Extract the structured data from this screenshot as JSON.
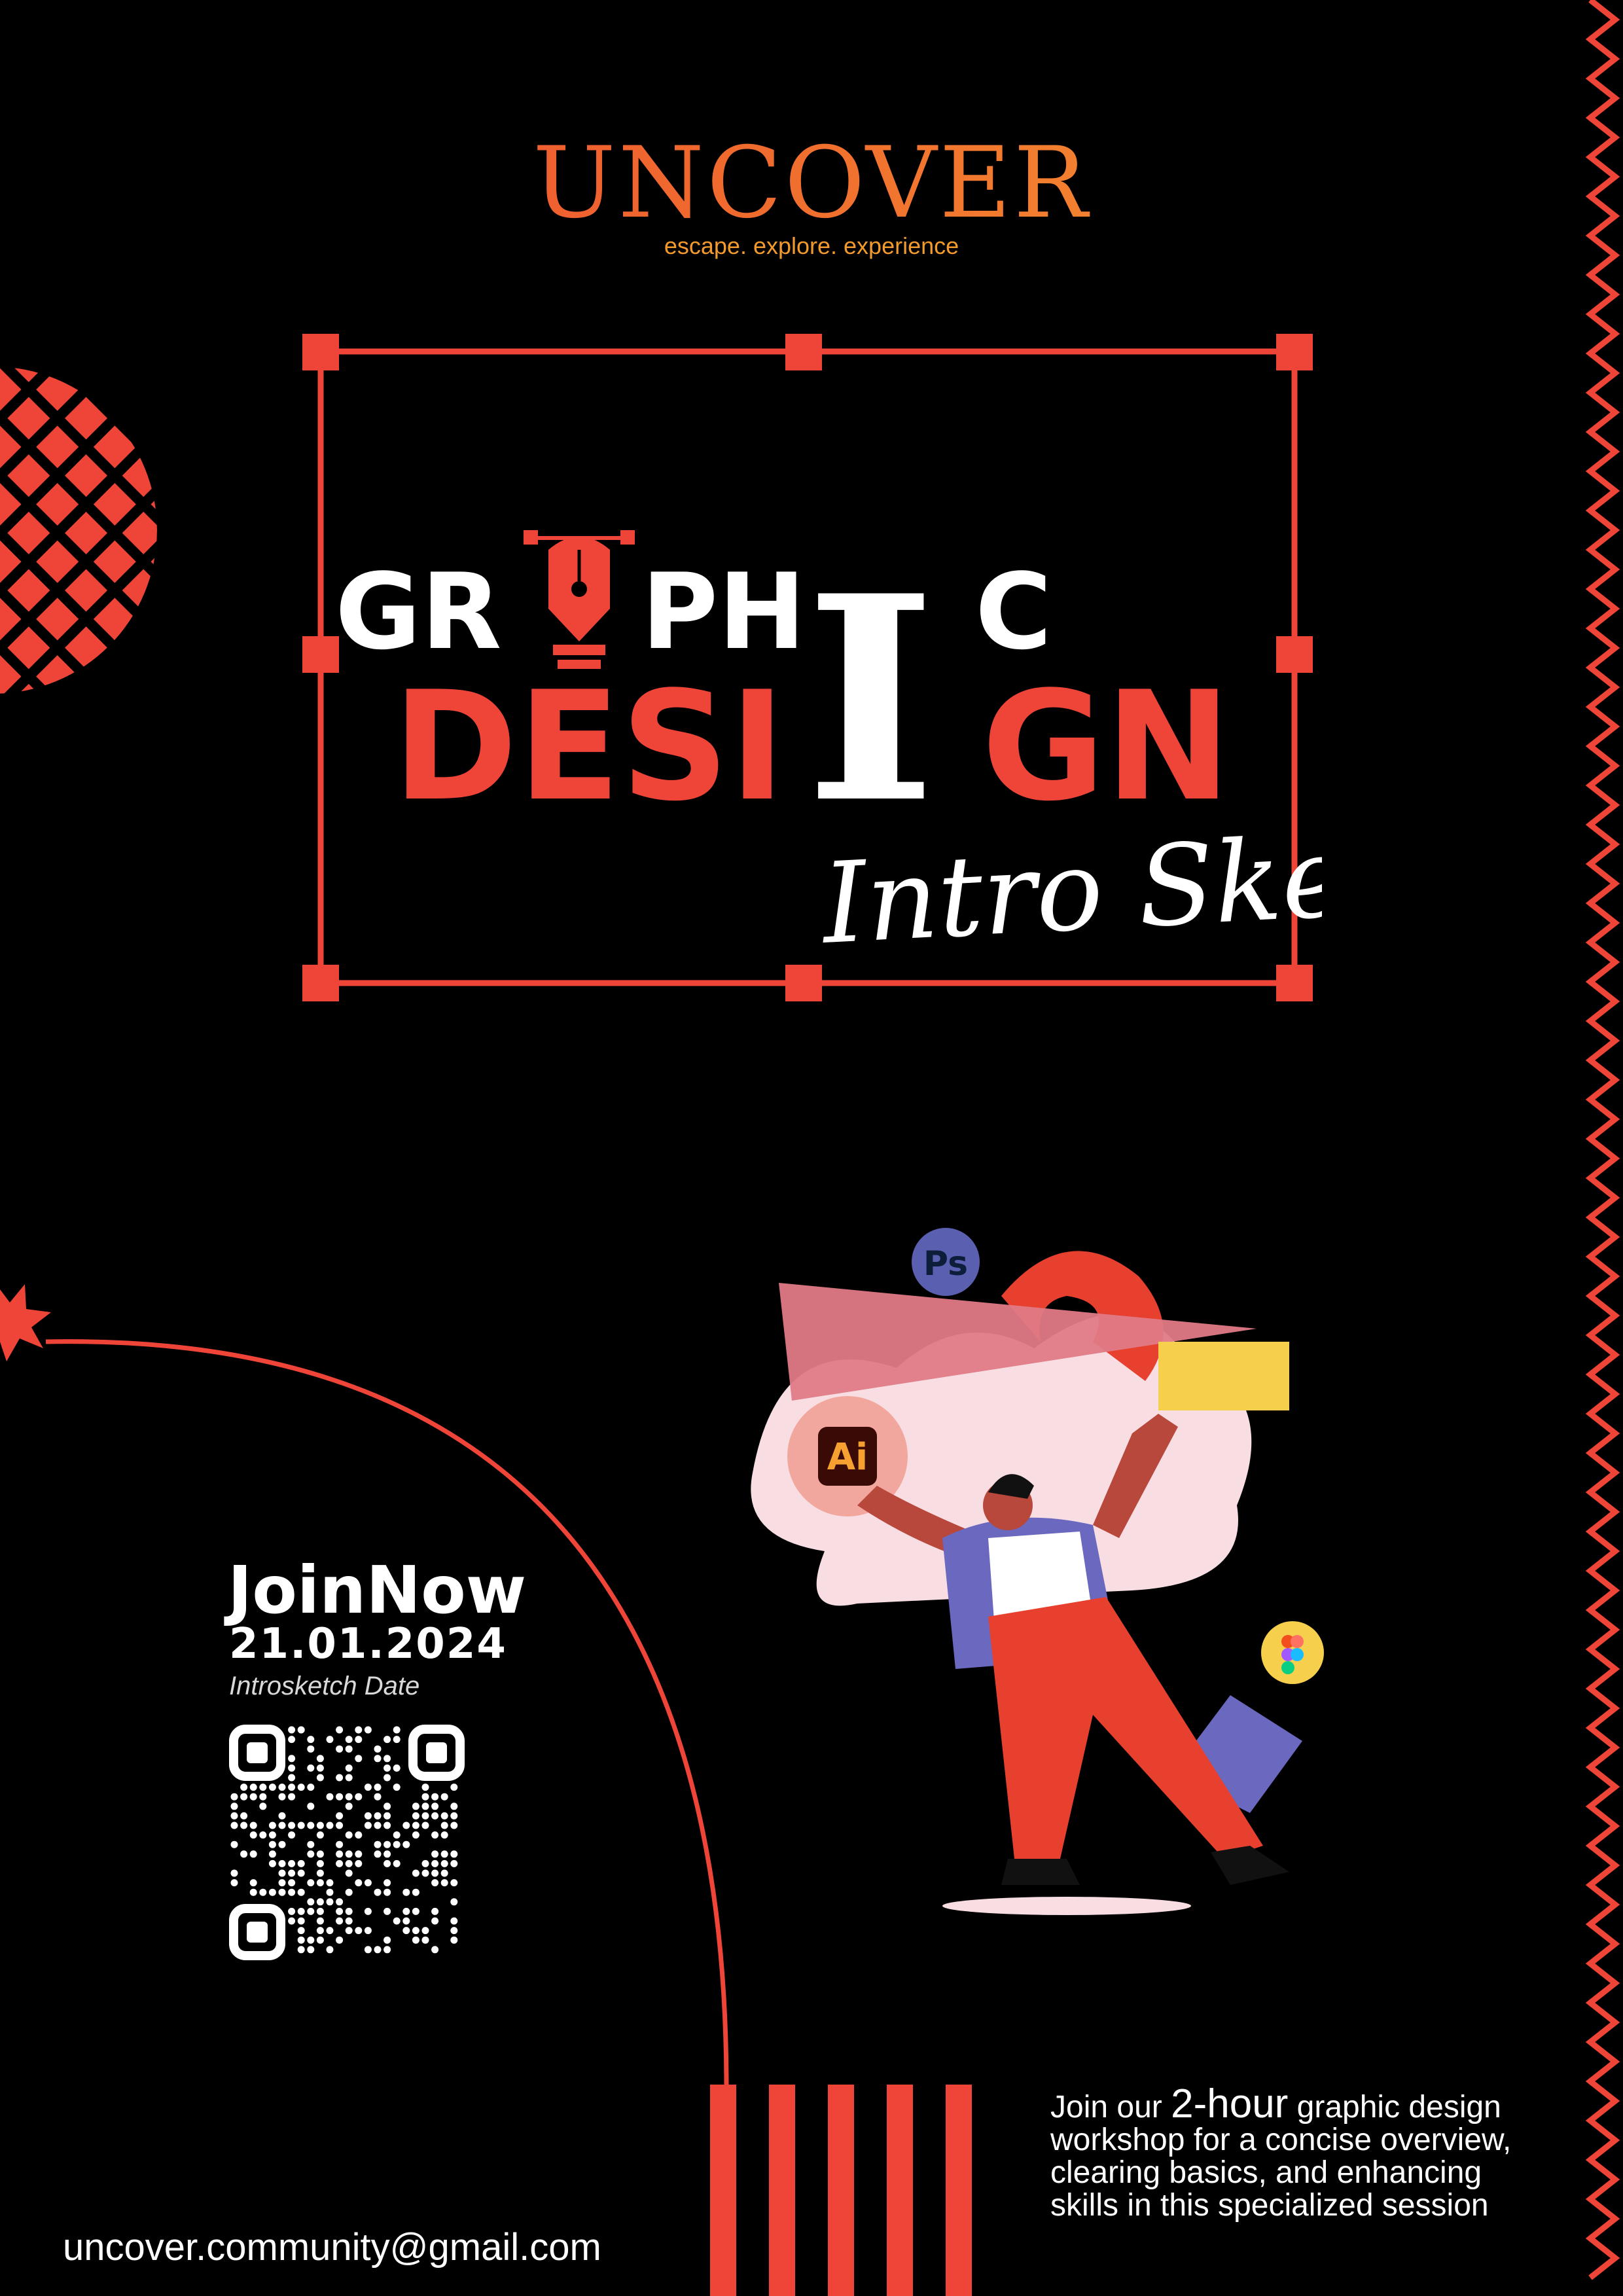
{
  "brand": {
    "name": "UNCOVER",
    "tagline": "escape. explore. experience"
  },
  "title": {
    "line1_part1": "GR",
    "line1_part2": "PH",
    "line1_part3": "C",
    "line2_part1": "DESI",
    "line2_big_letter": "I",
    "line2_part2": "GN",
    "script": "Intro Sketch"
  },
  "event": {
    "cta": "JoinNow",
    "date": "21.01.2024",
    "date_caption": "Introsketch Date"
  },
  "description": {
    "before": "Join our ",
    "highlight": "2-hour",
    "after": " graphic design workshop  for a concise overview, clearing basics, and enhancing skills in this specialized session"
  },
  "contact": {
    "email": "uncover.community@gmail.com"
  },
  "app_icons": {
    "photoshop": "Ps",
    "illustrator": "Ai",
    "figma": "figma-icon"
  },
  "colors": {
    "background": "#000000",
    "accent": "#ef4438",
    "brand_orange": "#f39a2c",
    "text": "#ffffff"
  }
}
